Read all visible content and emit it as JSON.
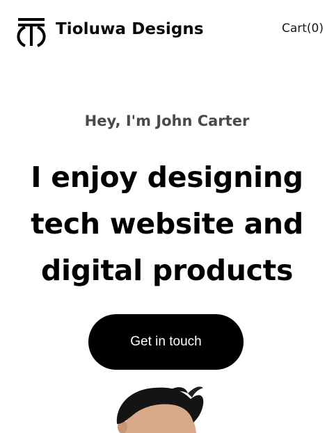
{
  "header": {
    "brand_name": "Tioluwa Designs",
    "logo_icon": "pillar-logo-icon",
    "cart_label": "Cart(0)"
  },
  "hero": {
    "greeting": "Hey, I'm John Carter",
    "headline_lines": [
      "I enjoy designing",
      "tech website and",
      "digital products"
    ],
    "cta_label": "Get in touch",
    "portrait_icon": "portrait-photo"
  },
  "colors": {
    "background": "#ffffff",
    "text": "#000000",
    "greeting": "#4a4a4a",
    "button_bg": "#000000",
    "button_text": "#ffffff"
  }
}
